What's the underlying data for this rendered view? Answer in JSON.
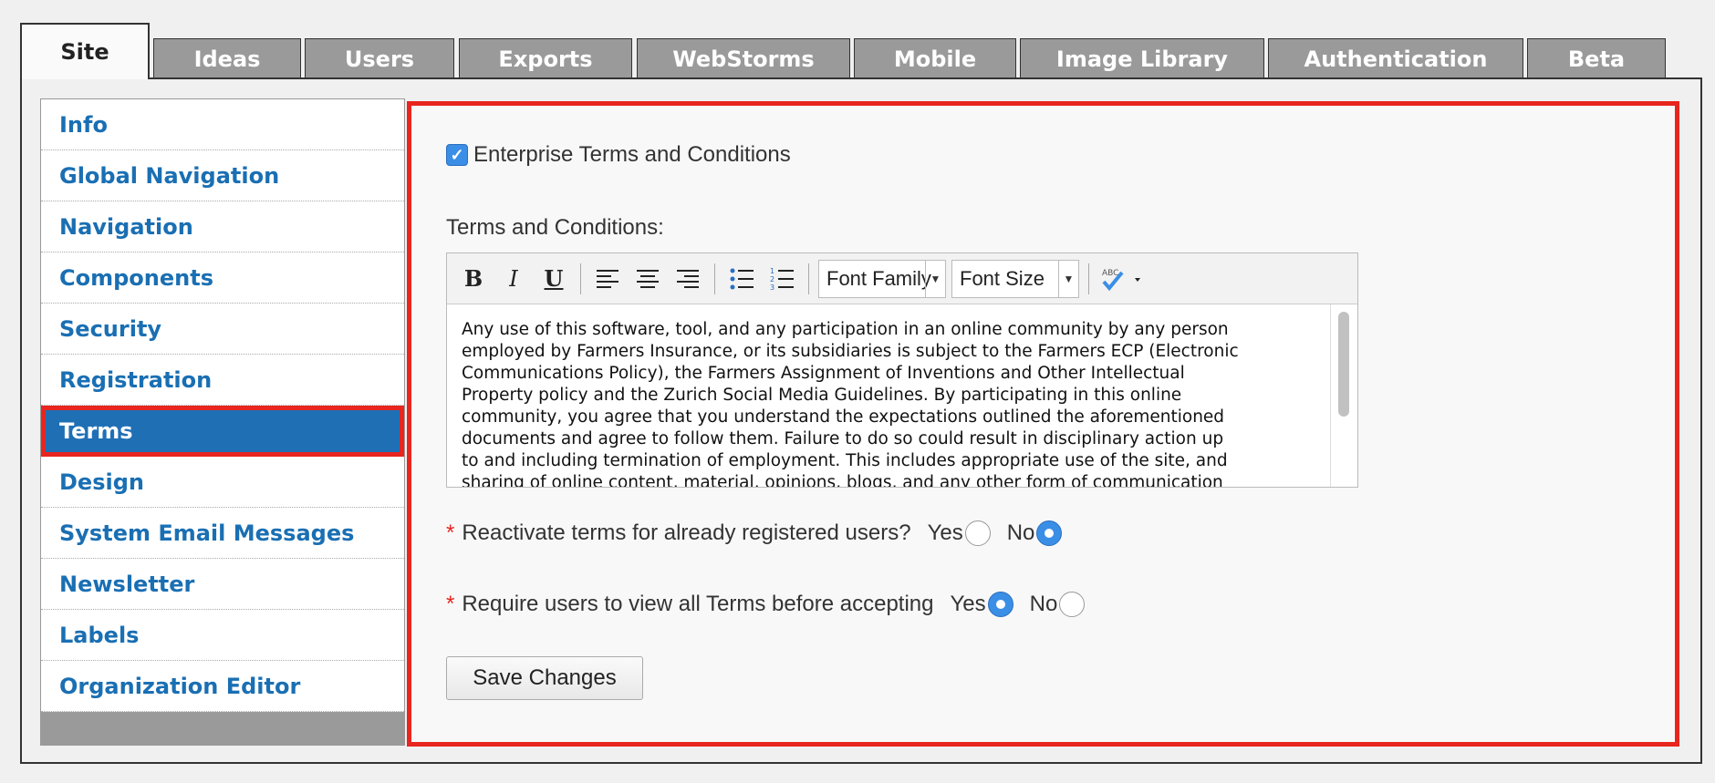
{
  "tabs": [
    "Site",
    "Ideas",
    "Users",
    "Exports",
    "WebStorms",
    "Mobile",
    "Image Library",
    "Authentication",
    "Beta"
  ],
  "active_tab": "Site",
  "sidebar": {
    "items": [
      {
        "label": "Info"
      },
      {
        "label": "Global Navigation"
      },
      {
        "label": "Navigation"
      },
      {
        "label": "Components"
      },
      {
        "label": "Security"
      },
      {
        "label": "Registration"
      },
      {
        "label": "Terms"
      },
      {
        "label": "Design"
      },
      {
        "label": "System Email Messages"
      },
      {
        "label": "Newsletter"
      },
      {
        "label": "Labels"
      },
      {
        "label": "Organization Editor"
      }
    ],
    "active": "Terms"
  },
  "main": {
    "enterprise_checkbox_label": "Enterprise Terms and Conditions",
    "enterprise_checked": true,
    "terms_label": "Terms and Conditions:",
    "editor": {
      "bold": "B",
      "italic": "I",
      "underline": "U",
      "font_family": "Font Family",
      "font_size": "Font Size",
      "spellcheck_icon_text": "ABC",
      "lines": [
        "Any use of this software, tool, and any participation in an online community by any person",
        "employed by Farmers Insurance, or its subsidiaries is subject to the Farmers ECP (Electronic",
        "Communications Policy), the Farmers Assignment of Inventions and Other Intellectual",
        "Property policy and the Zurich Social Media Guidelines. By participating in this online",
        "community, you agree that you understand the expectations outlined the aforementioned",
        "documents and agree to follow them. Failure to do so could result in disciplinary action up",
        "to and including termination of employment. This includes appropriate use of the site, and",
        "sharing of online content, material, opinions, blogs, and any other form of communication"
      ]
    },
    "required_marker": "*",
    "reactivate": {
      "question": "Reactivate terms for already registered users?",
      "yes": "Yes",
      "no": "No",
      "selected": "No"
    },
    "require_view": {
      "question": "Require users to view all Terms before accepting",
      "yes": "Yes",
      "no": "No",
      "selected": "Yes"
    },
    "save_label": "Save Changes"
  },
  "colors": {
    "accent_blue": "#1f6fb5",
    "link_blue": "#1a6fb3",
    "highlight_red": "#e8251e",
    "tab_gray": "#9a9a9a"
  }
}
